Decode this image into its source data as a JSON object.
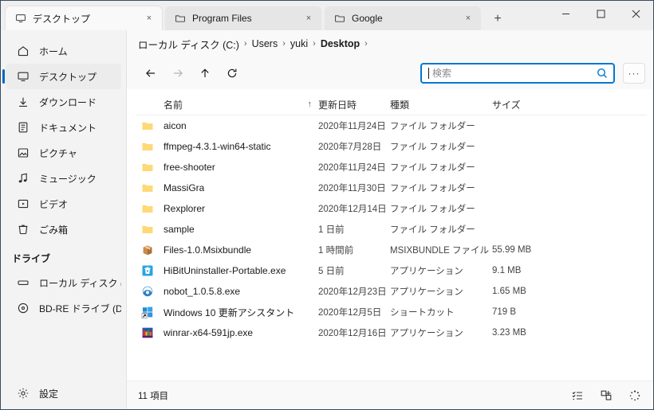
{
  "window": {
    "controls": {
      "minimize": "minimize-button",
      "maximize": "maximize-button",
      "close": "close-button"
    }
  },
  "tabs": {
    "new_tab_label": "+",
    "items": [
      {
        "label": "デスクトップ",
        "icon": "monitor-icon",
        "active": true,
        "close": "×"
      },
      {
        "label": "Program Files",
        "icon": "folder-outline-icon",
        "active": false,
        "close": "×"
      },
      {
        "label": "Google",
        "icon": "folder-outline-icon",
        "active": false,
        "close": "×"
      }
    ]
  },
  "sidebar": {
    "items": [
      {
        "label": "ホーム",
        "icon": "home-icon",
        "selected": false
      },
      {
        "label": "デスクトップ",
        "icon": "monitor-icon",
        "selected": true
      },
      {
        "label": "ダウンロード",
        "icon": "download-icon",
        "selected": false
      },
      {
        "label": "ドキュメント",
        "icon": "document-icon",
        "selected": false
      },
      {
        "label": "ピクチャ",
        "icon": "picture-icon",
        "selected": false
      },
      {
        "label": "ミュージック",
        "icon": "music-icon",
        "selected": false
      },
      {
        "label": "ビデオ",
        "icon": "video-icon",
        "selected": false
      },
      {
        "label": "ごみ箱",
        "icon": "recycle-bin-icon",
        "selected": false
      }
    ],
    "section_header": "ドライブ",
    "drives": [
      {
        "label": "ローカル ディスク (C:)",
        "icon": "drive-icon"
      },
      {
        "label": "BD-RE ドライブ (D:) LEON",
        "icon": "optical-drive-icon"
      }
    ],
    "settings": {
      "label": "設定",
      "icon": "gear-icon"
    }
  },
  "breadcrumb": {
    "separator": "›",
    "parts": [
      {
        "label": "ローカル ディスク (C:)",
        "current": false
      },
      {
        "label": "Users",
        "current": false
      },
      {
        "label": "yuki",
        "current": false
      },
      {
        "label": "Desktop",
        "current": true
      }
    ]
  },
  "toolbar": {
    "back": "back-arrow-icon",
    "forward": "forward-arrow-icon",
    "up": "up-arrow-icon",
    "refresh": "refresh-icon",
    "overflow_label": "···"
  },
  "search": {
    "placeholder": "検索",
    "value": "",
    "icon": "search-icon",
    "focused": true,
    "accent": "#0078d4"
  },
  "columns": {
    "name": "名前",
    "date": "更新日時",
    "type": "種類",
    "size": "サイズ",
    "sort_arrow": "↑"
  },
  "files": [
    {
      "name": "aicon",
      "date": "2020年11月24日",
      "type": "ファイル フォルダー",
      "size": "",
      "icon": "folder-icon"
    },
    {
      "name": "ffmpeg-4.3.1-win64-static",
      "date": "2020年7月28日",
      "type": "ファイル フォルダー",
      "size": "",
      "icon": "folder-icon"
    },
    {
      "name": "free-shooter",
      "date": "2020年11月24日",
      "type": "ファイル フォルダー",
      "size": "",
      "icon": "folder-icon"
    },
    {
      "name": "MassiGra",
      "date": "2020年11月30日",
      "type": "ファイル フォルダー",
      "size": "",
      "icon": "folder-icon"
    },
    {
      "name": "Rexplorer",
      "date": "2020年12月14日",
      "type": "ファイル フォルダー",
      "size": "",
      "icon": "folder-icon"
    },
    {
      "name": "sample",
      "date": "1 日前",
      "type": "ファイル フォルダー",
      "size": "",
      "icon": "folder-icon"
    },
    {
      "name": "Files-1.0.Msixbundle",
      "date": "1 時間前",
      "type": "MSIXBUNDLE ファイル",
      "size": "55.99 MB",
      "icon": "package-box-icon"
    },
    {
      "name": "HiBitUninstaller-Portable.exe",
      "date": "5 日前",
      "type": "アプリケーション",
      "size": "9.1 MB",
      "icon": "hibit-uninstaller-icon"
    },
    {
      "name": "nobot_1.0.5.8.exe",
      "date": "2020年12月23日",
      "type": "アプリケーション",
      "size": "1.65 MB",
      "icon": "nobot-swirl-icon"
    },
    {
      "name": "Windows 10 更新アシスタント",
      "date": "2020年12月5日",
      "type": "ショートカット",
      "size": "719 B",
      "icon": "windows-shortcut-icon"
    },
    {
      "name": "winrar-x64-591jp.exe",
      "date": "2020年12月16日",
      "type": "アプリケーション",
      "size": "3.23 MB",
      "icon": "winrar-icon"
    }
  ],
  "status": {
    "item_count": "11 項目",
    "view_buttons": [
      {
        "icon": "details-view-icon"
      },
      {
        "icon": "tiles-view-icon"
      },
      {
        "icon": "loading-spinner-icon"
      }
    ]
  }
}
